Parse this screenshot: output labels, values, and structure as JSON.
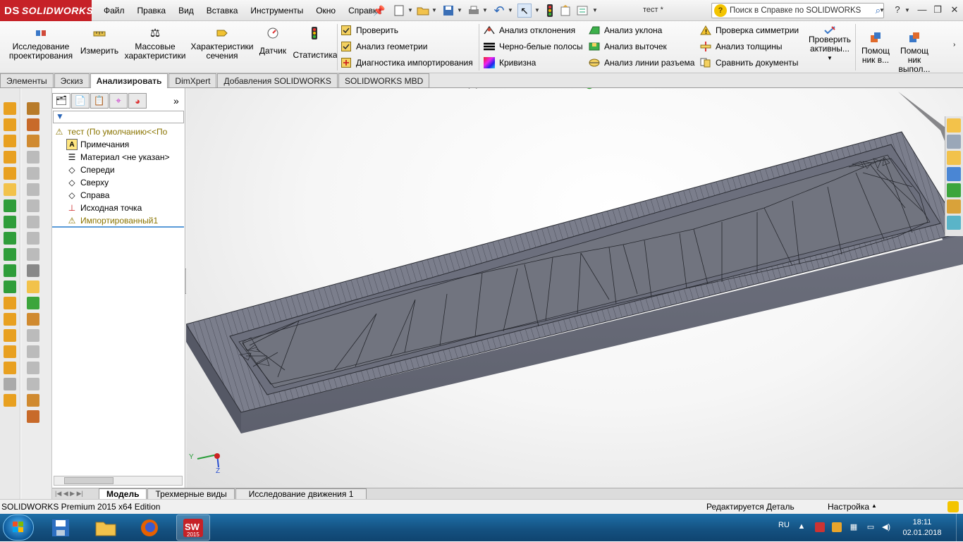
{
  "app": {
    "logo": "SOLIDWORKS",
    "logo_mark": "DS",
    "doc_title": "тест *"
  },
  "menu": [
    "Файл",
    "Правка",
    "Вид",
    "Вставка",
    "Инструменты",
    "Окно",
    "Справка"
  ],
  "help_search": {
    "placeholder": "Поиск в Справке по SOLIDWORKS"
  },
  "commands": {
    "design_study": "Исследование проектирования",
    "measure": "Измерить",
    "mass_props": "Массовые характеристики",
    "section_props": "Характеристики сечения",
    "sensor": "Датчик",
    "statistics": "Статистика",
    "check": "Проверить",
    "geometry_analysis": "Анализ геометрии",
    "import_diagnostics": "Диагностика импортирования",
    "deviation_analysis": "Анализ отклонения",
    "zebra_stripes": "Черно-белые полосы",
    "curvature": "Кривизна",
    "draft_analysis": "Анализ уклона",
    "undercut_analysis": "Анализ выточек",
    "parting_line_analysis": "Анализ линии разъема",
    "symmetry_check": "Проверка симметрии",
    "thickness_analysis": "Анализ толщины",
    "compare_documents": "Сравнить документы",
    "check_active": "Проверить активны...",
    "help1": "Помощ ник в...",
    "help2": "Помощ ник выпол..."
  },
  "tabs": [
    "Элементы",
    "Эскиз",
    "Анализировать",
    "DimXpert",
    "Добавления SOLIDWORKS",
    "SOLIDWORKS MBD"
  ],
  "active_tab": "Анализировать",
  "tree": {
    "root": "тест  (По умолчанию<<По",
    "items": [
      "Примечания",
      "Материал <не указан>",
      "Спереди",
      "Сверху",
      "Справа",
      "Исходная точка",
      "Импортированный1"
    ]
  },
  "model_tabs": [
    "Модель",
    "Трехмерные виды",
    "Исследование движения 1"
  ],
  "status": {
    "edition": "SOLIDWORKS Premium 2015 x64 Edition",
    "mode": "Редактируется Деталь",
    "custom": "Настройка"
  },
  "taskbar": {
    "lang": "RU",
    "time": "18:11",
    "date": "02.01.2018",
    "sw_badge": "2015"
  },
  "triad": {
    "y": "Y",
    "z": "Z"
  },
  "colors": {
    "brand_red": "#c62127",
    "model_gray": "#6f7280",
    "taskbar_blue": "#14507f"
  }
}
